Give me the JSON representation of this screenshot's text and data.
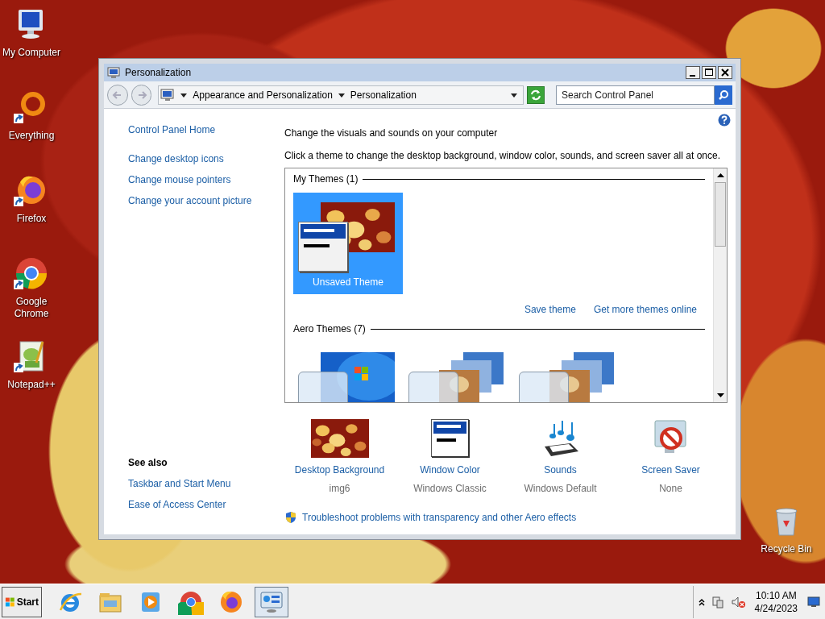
{
  "desktop_icons": [
    {
      "label": "My Computer",
      "kind": "computer",
      "shortcut": false
    },
    {
      "label": "Everything",
      "kind": "everything",
      "shortcut": true
    },
    {
      "label": "Firefox",
      "kind": "firefox",
      "shortcut": true
    },
    {
      "label": "Google Chrome",
      "kind": "chrome",
      "shortcut": true
    },
    {
      "label": "Notepad++",
      "kind": "notepad",
      "shortcut": true
    },
    {
      "label": "Recycle Bin",
      "kind": "recycle",
      "shortcut": false
    }
  ],
  "window": {
    "title": "Personalization",
    "breadcrumbs": [
      "Appearance and Personalization",
      "Personalization"
    ],
    "search": {
      "placeholder": "Search Control Panel"
    },
    "sidebar": {
      "links": [
        "Control Panel Home",
        "Change desktop icons",
        "Change mouse pointers",
        "Change your account picture"
      ],
      "see_also": {
        "heading": "See also",
        "links": [
          "Taskbar and Start Menu",
          "Ease of Access Center"
        ]
      }
    },
    "main": {
      "heading": "Change the visuals and sounds on your computer",
      "description": "Click a theme to change the desktop background, window color, sounds, and screen saver all at once.",
      "theme_groups": [
        {
          "title": "My Themes (1)",
          "themes": [
            {
              "label": "Unsaved Theme",
              "kind": "custom",
              "selected": true
            }
          ],
          "links": [
            "Save theme",
            "Get more themes online"
          ]
        },
        {
          "title": "Aero Themes (7)",
          "themes": [
            {
              "kind": "single",
              "selected": false
            },
            {
              "kind": "stack",
              "selected": false
            },
            {
              "kind": "stack",
              "selected": false
            }
          ]
        }
      ],
      "settings": [
        {
          "label": "Desktop Background",
          "value": "img6",
          "kind": "background"
        },
        {
          "label": "Window Color",
          "value": "Windows Classic",
          "kind": "color"
        },
        {
          "label": "Sounds",
          "value": "Windows Default",
          "kind": "sounds"
        },
        {
          "label": "Screen Saver",
          "value": "None",
          "kind": "screensaver"
        }
      ],
      "troubleshoot": "Troubleshoot problems with transparency and other Aero effects"
    }
  },
  "taskbar": {
    "start": "Start",
    "apps": [
      {
        "kind": "ie",
        "active": false
      },
      {
        "kind": "explorer",
        "active": false
      },
      {
        "kind": "media",
        "active": false
      },
      {
        "kind": "chrome",
        "active": false
      },
      {
        "kind": "firefox",
        "active": false
      },
      {
        "kind": "control",
        "active": true
      }
    ],
    "time": "10:10 AM",
    "date": "4/24/2023"
  }
}
